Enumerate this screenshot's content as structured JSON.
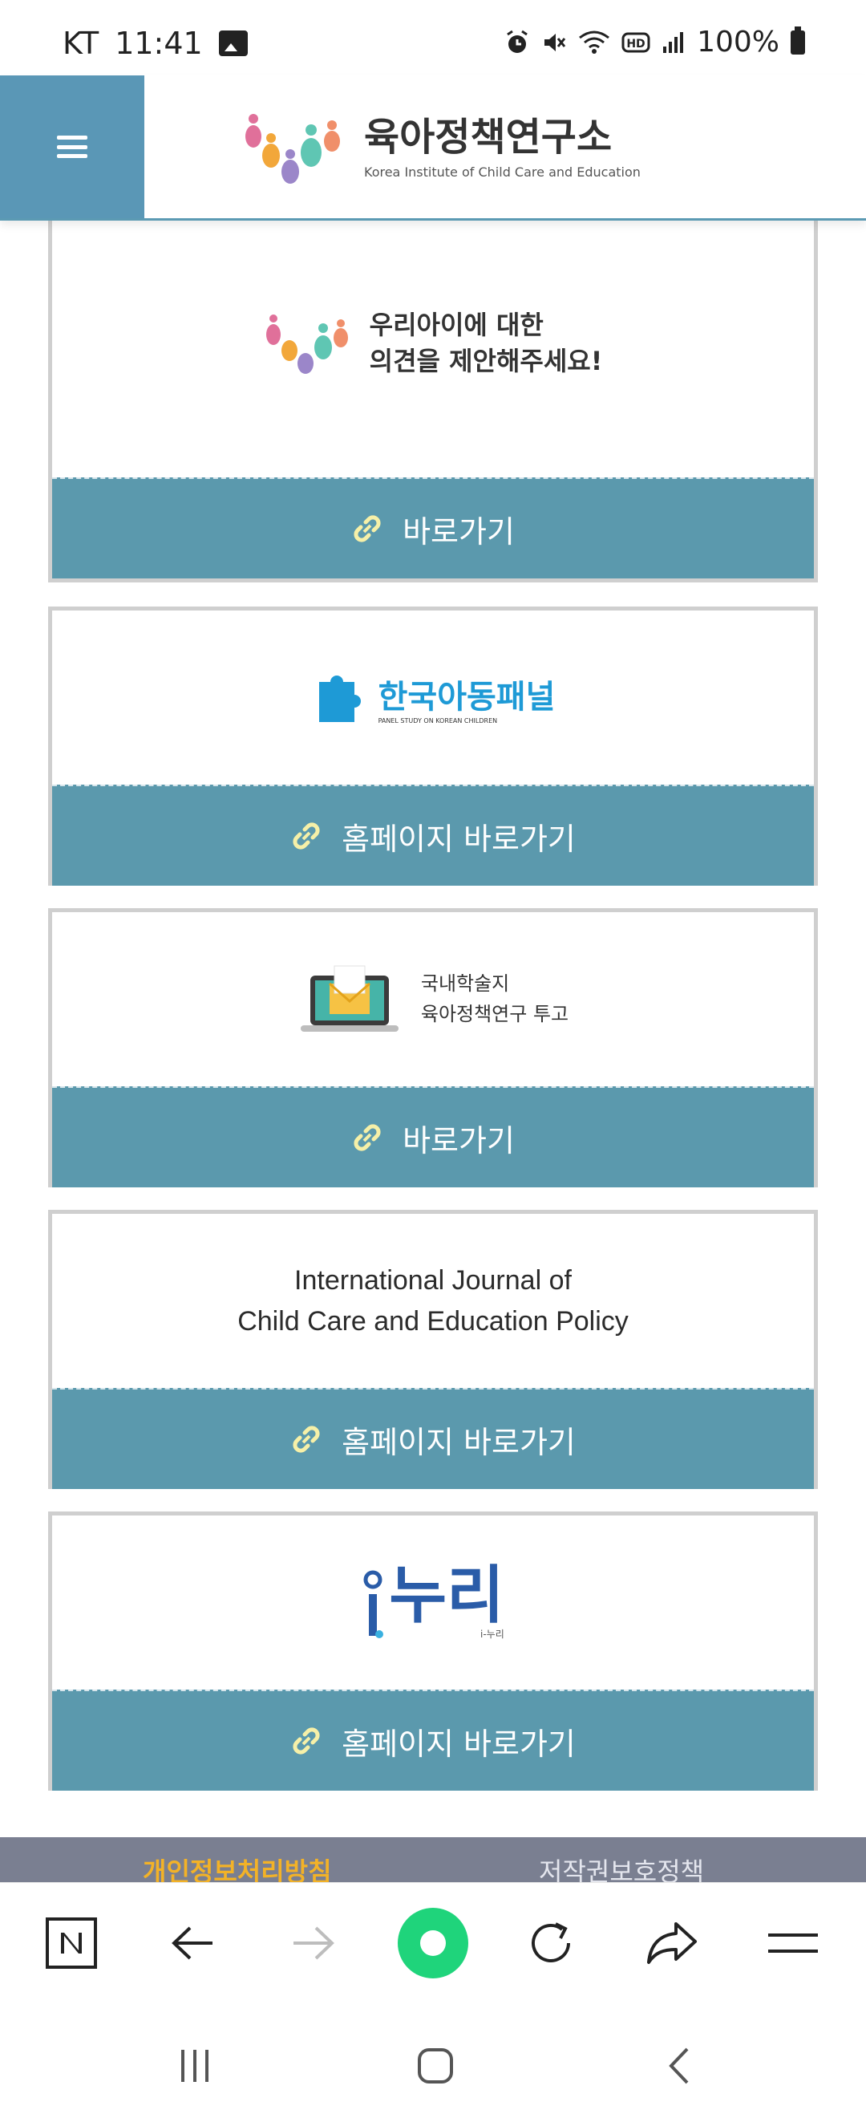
{
  "status_bar": {
    "carrier": "KT",
    "time": "11:41",
    "battery": "100%",
    "icons": [
      "gallery-icon",
      "alarm-icon",
      "mute-icon",
      "wifi-icon",
      "hd-icon",
      "signal-icon",
      "battery-icon"
    ]
  },
  "header": {
    "menu_icon": "hamburger-menu-icon",
    "logo_title": "육아정책연구소",
    "logo_subtitle": "Korea Institute of Child Care and Education"
  },
  "cards": [
    {
      "image_text_line1": "우리아이에 대한",
      "image_text_line2": "의견을 제안해주세요!",
      "button_label": "바로가기"
    },
    {
      "image_text_main": "한국아동패널",
      "image_text_sub": "PANEL STUDY ON KOREAN CHILDREN",
      "button_label": "홈페이지 바로가기"
    },
    {
      "image_text_line1": "국내학술지",
      "image_text_line2": "육아정책연구 투고",
      "button_label": "바로가기"
    },
    {
      "image_text_line1": "International Journal of",
      "image_text_line2": "Child Care and Education Policy",
      "button_label": "홈페이지 바로가기"
    },
    {
      "image_text_main": "누리",
      "image_text_sub": "i-누리",
      "button_label": "홈페이지 바로가기"
    }
  ],
  "footer": {
    "link1": "개인정보처리방침",
    "link2": "저작권보호정책"
  },
  "toolbar": {
    "items": [
      "naver-n-icon",
      "back-arrow-icon",
      "forward-arrow-icon",
      "green-dot-home-icon",
      "refresh-icon",
      "share-icon",
      "menu-icon"
    ]
  },
  "colors": {
    "accent": "#5b99ad",
    "menu_bg": "#5a97b6",
    "footer_bg": "#7a7f91",
    "footer_link_highlight": "#f3b227",
    "green_button": "#1fd47b"
  }
}
